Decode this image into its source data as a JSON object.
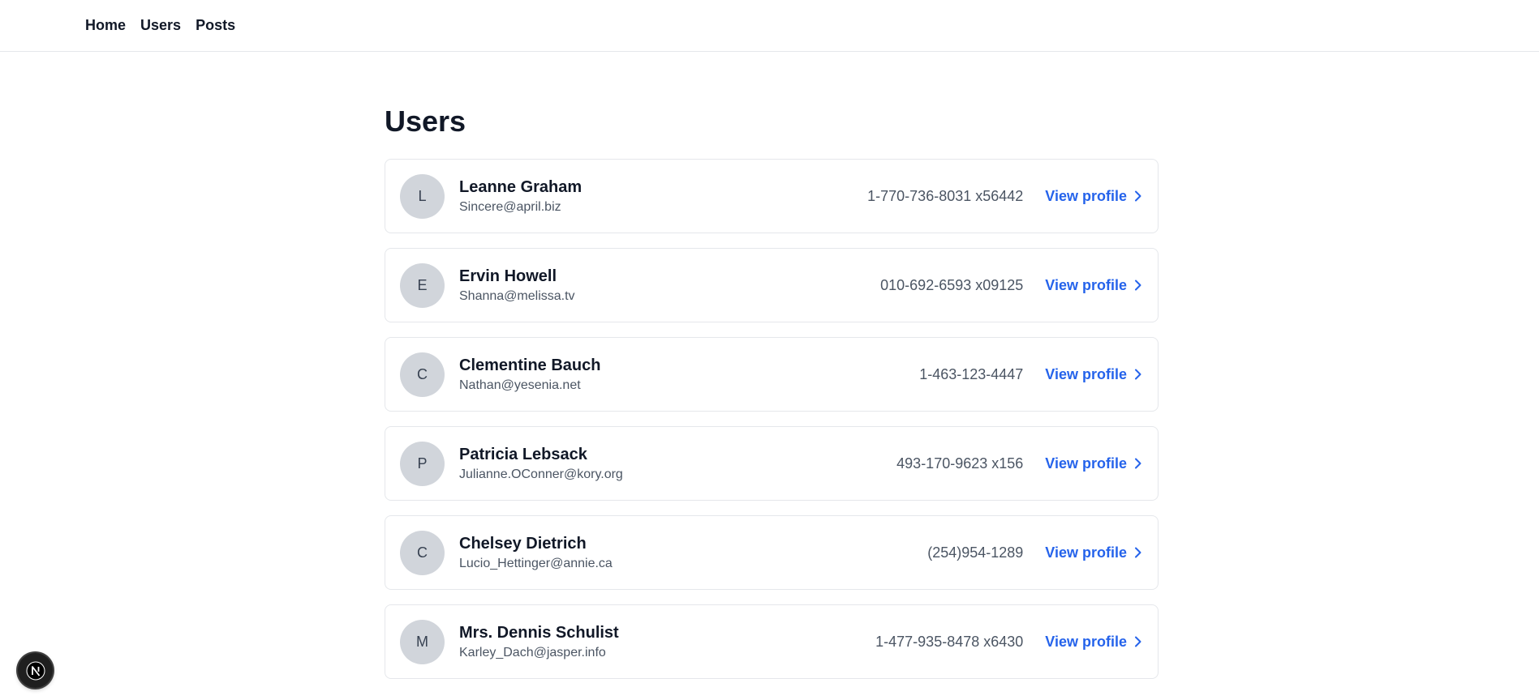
{
  "nav": {
    "items": [
      {
        "label": "Home"
      },
      {
        "label": "Users"
      },
      {
        "label": "Posts"
      }
    ]
  },
  "page": {
    "title": "Users"
  },
  "users": [
    {
      "initial": "L",
      "name": "Leanne Graham",
      "email": "Sincere@april.biz",
      "phone": "1-770-736-8031 x56442",
      "link_label": "View profile"
    },
    {
      "initial": "E",
      "name": "Ervin Howell",
      "email": "Shanna@melissa.tv",
      "phone": "010-692-6593 x09125",
      "link_label": "View profile"
    },
    {
      "initial": "C",
      "name": "Clementine Bauch",
      "email": "Nathan@yesenia.net",
      "phone": "1-463-123-4447",
      "link_label": "View profile"
    },
    {
      "initial": "P",
      "name": "Patricia Lebsack",
      "email": "Julianne.OConner@kory.org",
      "phone": "493-170-9623 x156",
      "link_label": "View profile"
    },
    {
      "initial": "C",
      "name": "Chelsey Dietrich",
      "email": "Lucio_Hettinger@annie.ca",
      "phone": "(254)954-1289",
      "link_label": "View profile"
    },
    {
      "initial": "M",
      "name": "Mrs. Dennis Schulist",
      "email": "Karley_Dach@jasper.info",
      "phone": "1-477-935-8478 x6430",
      "link_label": "View profile"
    }
  ],
  "dev_badge": {
    "icon": "nextjs-logo-icon"
  },
  "colors": {
    "link": "#2563eb",
    "avatar_bg": "#d1d5db",
    "border": "#e5e7eb"
  }
}
